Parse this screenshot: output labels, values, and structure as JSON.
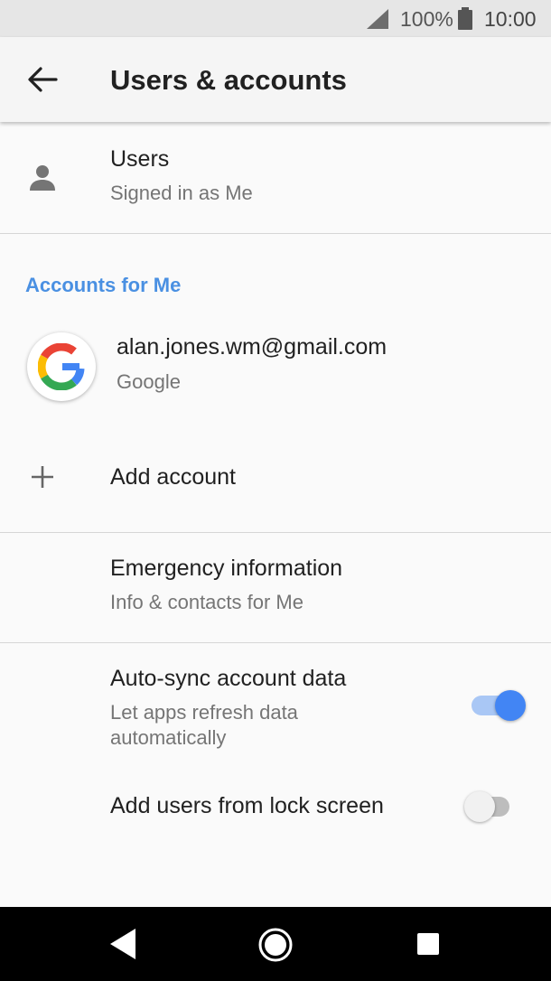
{
  "status_bar": {
    "battery_percent": "100%",
    "time": "10:00",
    "icons": [
      "signal-icon",
      "battery-icon"
    ]
  },
  "app_bar": {
    "title": "Users & accounts",
    "back_icon": "arrow-back-icon"
  },
  "users": {
    "title": "Users",
    "subtitle": "Signed in as Me",
    "icon": "person-icon"
  },
  "accounts_section": {
    "header": "Accounts for Me",
    "accounts": [
      {
        "email": "alan.jones.wm@gmail.com",
        "type": "Google",
        "icon": "google-logo-icon"
      }
    ],
    "add_account": {
      "label": "Add account",
      "icon": "plus-icon"
    }
  },
  "emergency": {
    "title": "Emergency information",
    "subtitle": "Info & contacts for Me"
  },
  "auto_sync": {
    "title": "Auto-sync account data",
    "subtitle_line1": "Let apps refresh data",
    "subtitle_line2": "automatically",
    "enabled": true
  },
  "lock_screen_users": {
    "title": "Add users from lock screen",
    "enabled": false
  },
  "nav_bar": {
    "icons": [
      "back-triangle-icon",
      "home-circle-icon",
      "recents-square-icon"
    ]
  },
  "colors": {
    "accent": "#4285f4",
    "section_header": "#4a90e2",
    "status_bar_bg": "#e6e6e6",
    "nav_bar_bg": "#000000"
  }
}
